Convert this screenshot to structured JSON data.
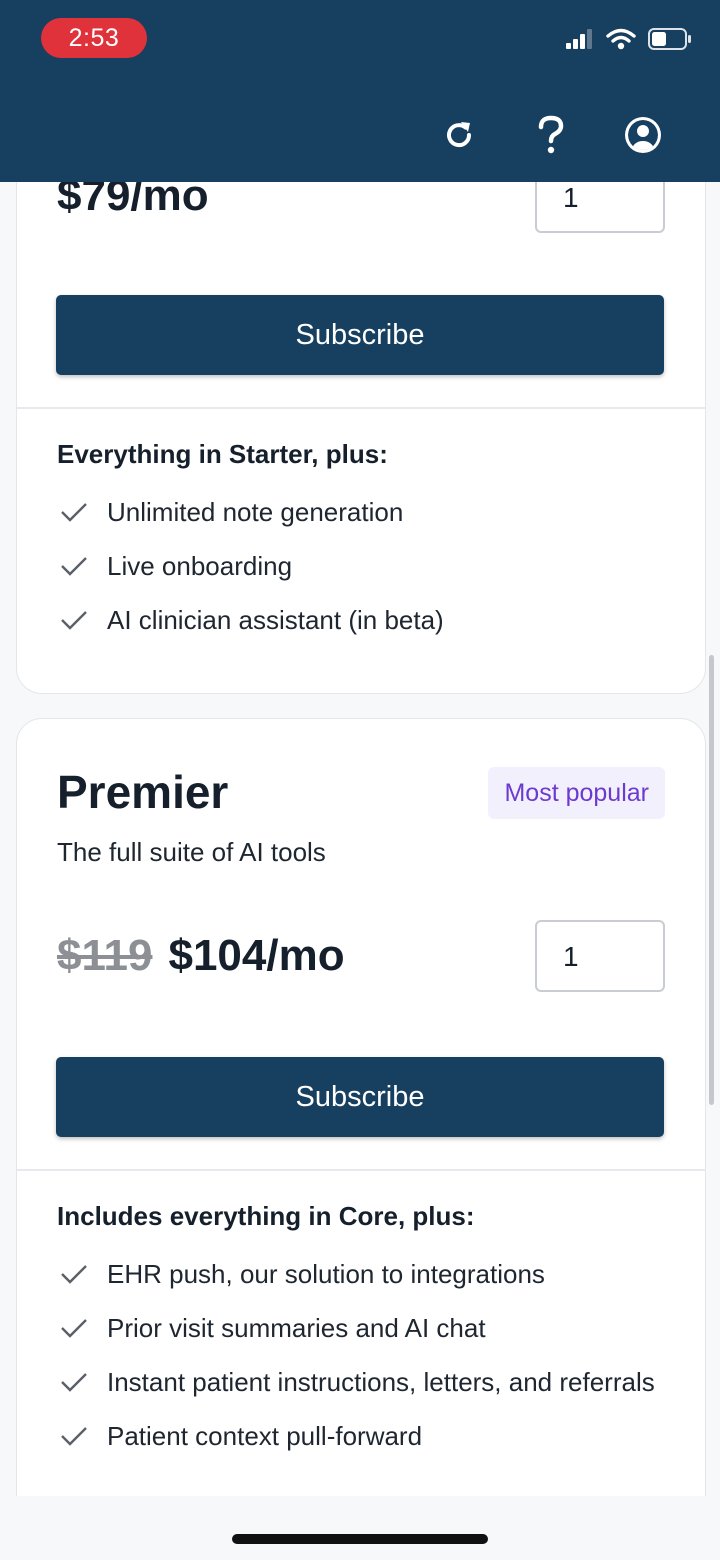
{
  "status_bar": {
    "time": "2:53"
  },
  "icons": {
    "refresh": "refresh-icon",
    "help": "help-icon",
    "account": "account-icon",
    "check": "check-icon"
  },
  "colors": {
    "header_bg": "#163f60",
    "button_bg": "#163f60",
    "badge_text": "#6b3bd0",
    "badge_bg": "#f3f0fd",
    "time_pill": "#e0323a"
  },
  "core_plan": {
    "price": "$79/mo",
    "quantity": "1",
    "subscribe_label": "Subscribe",
    "features_title": "Everything in Starter, plus:",
    "features": [
      "Unlimited note generation",
      "Live onboarding",
      "AI clinician assistant (in beta)"
    ]
  },
  "premier_plan": {
    "name": "Premier",
    "badge": "Most popular",
    "description": "The full suite of AI tools",
    "old_price": "$119",
    "price": "$104/mo",
    "quantity": "1",
    "subscribe_label": "Subscribe",
    "features_title": "Includes everything in Core, plus:",
    "features": [
      "EHR push, our solution to integrations",
      "Prior visit summaries and AI chat",
      "Instant patient instructions, letters, and referrals",
      "Patient context pull-forward"
    ]
  }
}
